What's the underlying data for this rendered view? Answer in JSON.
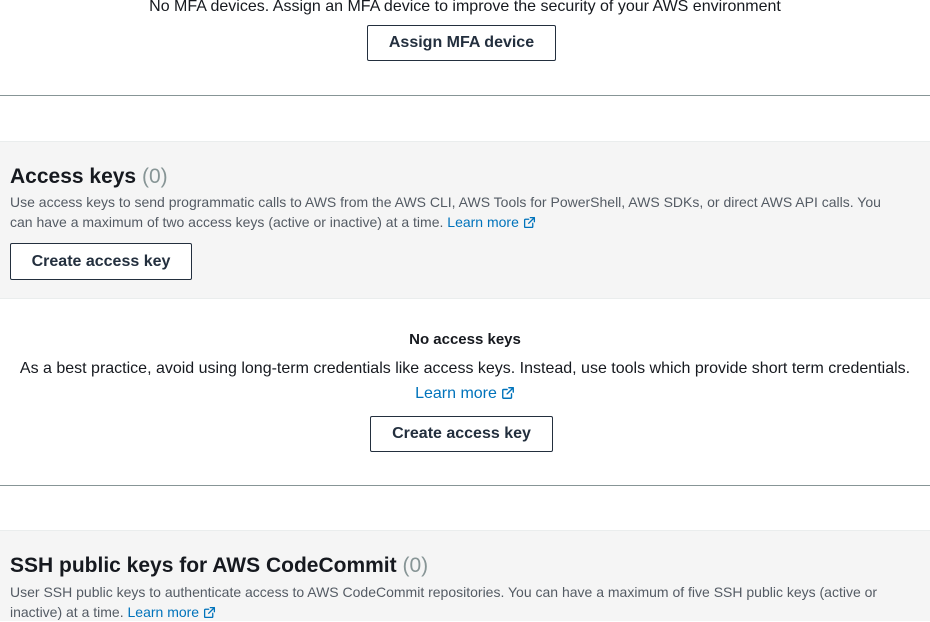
{
  "mfa": {
    "empty_message": "No MFA devices. Assign an MFA device to improve the security of your AWS environment",
    "assign_button": "Assign MFA device"
  },
  "access_keys": {
    "title": "Access keys",
    "count": "(0)",
    "description": "Use access keys to send programmatic calls to AWS from the AWS CLI, AWS Tools for PowerShell, AWS SDKs, or direct AWS API calls. You can have a maximum of two access keys (active or inactive) at a time.",
    "learn_more": "Learn more",
    "create_button": "Create access key",
    "empty": {
      "title": "No access keys",
      "description": "As a best practice, avoid using long-term credentials like access keys. Instead, use tools which provide short term credentials.",
      "learn_more": "Learn more",
      "create_button": "Create access key"
    }
  },
  "ssh_keys": {
    "title": "SSH public keys for AWS CodeCommit",
    "count": "(0)",
    "description": "User SSH public keys to authenticate access to AWS CodeCommit repositories. You can have a maximum of five SSH public keys (active or inactive) at a time.",
    "learn_more": "Learn more"
  },
  "colors": {
    "link": "#0073bb",
    "header_bg": "#f5f5f5",
    "button_border": "#232f3e",
    "muted_count": "#879596"
  },
  "icons": [
    "external-link-icon"
  ]
}
